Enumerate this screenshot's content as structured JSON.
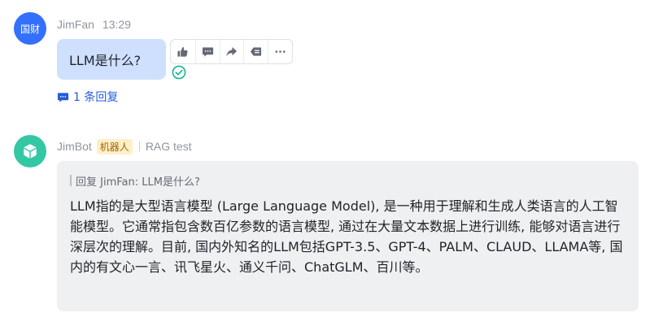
{
  "message1": {
    "avatar_text": "国财",
    "author": "JimFan",
    "time": "13:29",
    "text": "LLM是什么?",
    "toolbar_icons": [
      "thumbs-up-icon",
      "comment-icon",
      "forward-icon",
      "reply-icon",
      "more-icon"
    ],
    "reply_count": "1 条回复"
  },
  "message2": {
    "author": "JimBot",
    "badge": "机器人",
    "tag": "RAG test",
    "quote": "回复 JimFan:  LLM是什么?",
    "answer": "LLM指的是大型语言模型 (Large Language Model), 是一种用于理解和生成人类语言的人工智能模型。它通常指包含数百亿参数的语言模型, 通过在大量文本数据上进行训练, 能够对语言进行深层次的理解。目前, 国内外知名的LLM包括GPT-3.5、GPT-4、PALM、CLAUD、LLAMA等, 国内的有文心一言、讯飞星火、通义千问、ChatGLM、百川等。"
  },
  "colors": {
    "user_avatar": "#3370ff",
    "bot_avatar": "#34c7a4",
    "user_bubble": "#cfe0ff",
    "bot_bubble": "#eff0f1",
    "link": "#245bdb",
    "read_check": "#14b890"
  }
}
